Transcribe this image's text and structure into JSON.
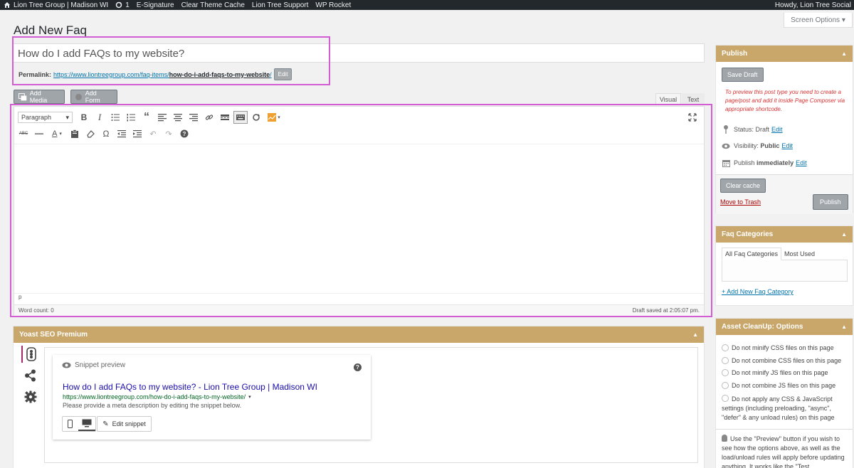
{
  "admin_bar": {
    "site_name": "Lion Tree Group | Madison WI",
    "updates_count": "1",
    "esignature": "E-Signature",
    "clear_theme_cache": "Clear Theme Cache",
    "support": "Lion Tree Support",
    "wp_rocket": "WP Rocket",
    "howdy": "Howdy, Lion Tree Social"
  },
  "screen_options": "Screen Options ▾",
  "page_title": "Add New Faq",
  "post": {
    "title": "How do I add FAQs to my website?",
    "permalink_label": "Permalink:",
    "permalink_base": "https://www.liontreegroup.com/faq-items/",
    "permalink_slug": "how-do-i-add-faqs-to-my-website",
    "permalink_trailing": "/",
    "edit_label": "Edit"
  },
  "media": {
    "add_media": "Add Media",
    "add_form": "Add Form"
  },
  "editor": {
    "tab_visual": "Visual",
    "tab_text": "Text",
    "format": "Paragraph",
    "path": "p",
    "word_count": "Word count: 0",
    "draft_saved": "Draft saved at 2:05:07 pm."
  },
  "publish": {
    "title": "Publish",
    "save_draft": "Save Draft",
    "notice": "To preview this post type you need to create a page/post and add it inside Page Composer via appropriate shortcode.",
    "status_label": "Status:",
    "status_value": "Draft",
    "visibility_label": "Visibility:",
    "visibility_value": "Public",
    "schedule": "Publish",
    "schedule_value": "immediately",
    "edit": "Edit",
    "clear_cache": "Clear cache",
    "move_to_trash": "Move to Trash",
    "publish_button": "Publish"
  },
  "faq_categories": {
    "title": "Faq Categories",
    "tab_all": "All Faq Categories",
    "tab_most_used": "Most Used",
    "add_new": "+ Add New Faq Category"
  },
  "asset_cleanup": {
    "title": "Asset CleanUp: Options",
    "options": [
      "Do not minify CSS files on this page",
      "Do not combine CSS files on this page",
      "Do not minify JS files on this page",
      "Do not combine JS files on this page",
      "Do not apply any CSS & JavaScript settings (including preloading, \"async\", \"defer\" & any unload rules) on this page"
    ],
    "tip": "Use the \"Preview\" button if you wish to see how the options above, as well as the load/unload rules will apply before updating anything. It works like the \"Test"
  },
  "yoast": {
    "title": "Yoast SEO Premium",
    "snippet_label": "Snippet preview",
    "snippet_title": "How do I add FAQs to my website? - Lion Tree Group | Madison WI",
    "snippet_url": "https://www.liontreegroup.com/how-do-i-add-faqs-to-my-website/",
    "snippet_desc": "Please provide a meta description by editing the snippet below.",
    "edit_snippet": "Edit snippet"
  },
  "colors": {
    "accent": "#c9a76b",
    "admin_bar": "#23282d",
    "highlight": "#d35ed3",
    "link": "#0073aa",
    "notice": "#dc3232"
  }
}
